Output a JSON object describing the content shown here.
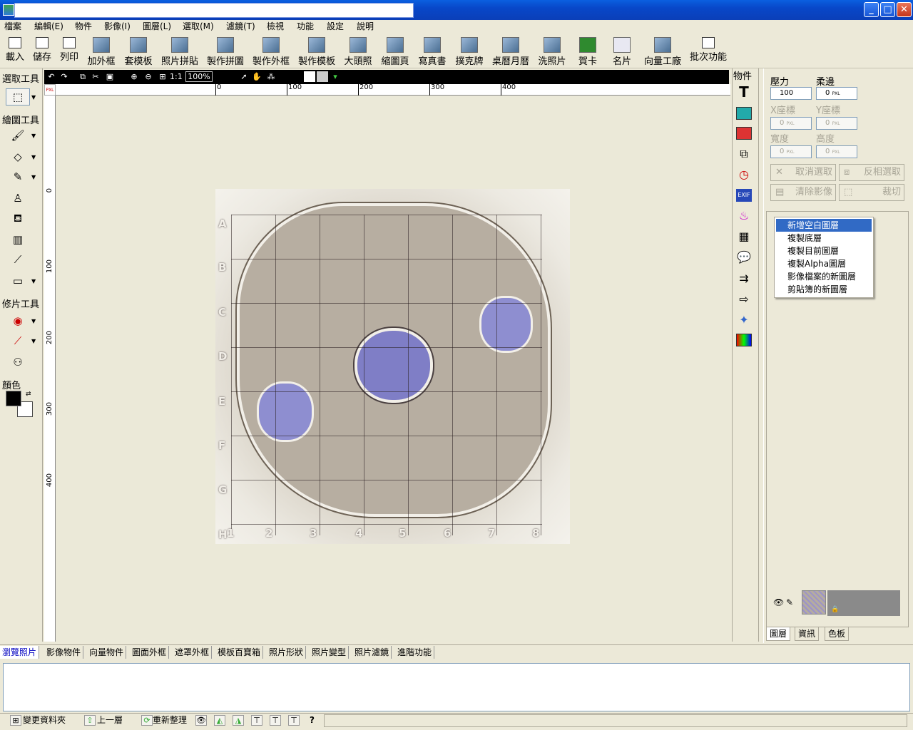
{
  "window": {
    "title": "",
    "minimize": "_",
    "maximize": "□",
    "close": "✕"
  },
  "menu": [
    "檔案",
    "編輯(E)",
    "物件",
    "影像(I)",
    "圖層(L)",
    "選取(M)",
    "濾鏡(T)",
    "檢視",
    "功能",
    "設定",
    "說明"
  ],
  "toolbar": [
    "載入",
    "儲存",
    "列印",
    "加外框",
    "套模板",
    "照片拼貼",
    "製作拼圖",
    "製作外框",
    "製作模板",
    "大頭照",
    "縮圖頁",
    "寫真書",
    "撲克牌",
    "桌曆月曆",
    "洗照片",
    "賀卡",
    "名片",
    "向量工廠",
    "批次功能"
  ],
  "left_panel": {
    "select_tools": "選取工具",
    "draw_tools": "繪圖工具",
    "retouch_tools": "修片工具",
    "color": "顏色"
  },
  "canvas": {
    "zoom": "100%",
    "unit": "PXL",
    "ruler_h": [
      "0",
      "100",
      "200",
      "300",
      "400"
    ],
    "ruler_v": [
      "0",
      "100",
      "200",
      "300",
      "400"
    ]
  },
  "map": {
    "rows": [
      "A",
      "B",
      "C",
      "D",
      "E",
      "F",
      "G",
      "H"
    ],
    "cols": [
      "1",
      "2",
      "3",
      "4",
      "5",
      "6",
      "7",
      "8"
    ]
  },
  "objects_label": "物件",
  "props": {
    "pressure_label": "壓力",
    "pressure_value": "100",
    "feather_label": "柔邊",
    "feather_value": "0",
    "x_label": "X座標",
    "x_value": "0",
    "y_label": "Y座標",
    "y_value": "0",
    "width_label": "寬度",
    "width_value": "0",
    "height_label": "高度",
    "height_value": "0",
    "unit": "PXL",
    "cancel_select": "取消選取",
    "invert_select": "反相選取",
    "clear_image": "清除影像",
    "crop": "裁切"
  },
  "context_menu": [
    "新增空白圖層",
    "複製底層",
    "複製目前圖層",
    "複製Alpha圖層",
    "影像檔案的新圖層",
    "剪貼簿的新圖層"
  ],
  "right_tabs": [
    "圖層",
    "資訊",
    "色板"
  ],
  "bottom_tabs": [
    "瀏覽照片",
    "影像物件",
    "向量物件",
    "圖面外框",
    "遮罩外框",
    "模板百寶箱",
    "照片形狀",
    "照片變型",
    "照片濾鏡",
    "進階功能"
  ],
  "status": {
    "change_folder": "變更資料夾",
    "up": "上一層",
    "refresh": "重新整理",
    "help": "?"
  }
}
